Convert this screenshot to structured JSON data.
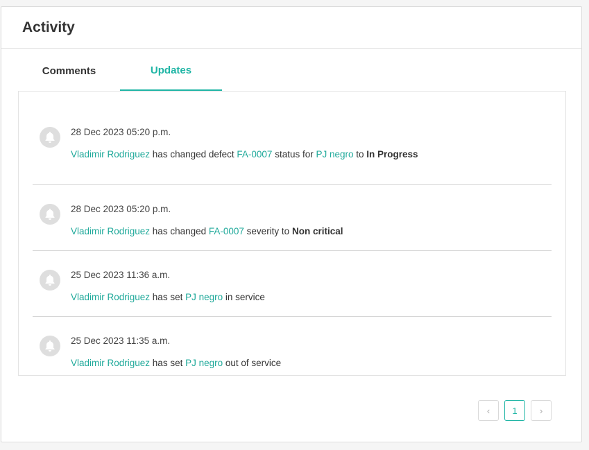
{
  "card": {
    "title": "Activity"
  },
  "tabs": [
    {
      "label": "Comments",
      "active": false
    },
    {
      "label": "Updates",
      "active": true
    }
  ],
  "activities": [
    {
      "time": "28 Dec 2023 05:20 p.m.",
      "user": "Vladimir Rodriguez",
      "t1": " has changed defect ",
      "defect": "FA-0007",
      "t2": " status for ",
      "asset": "PJ negro",
      "t3": " to ",
      "value": "In Progress"
    },
    {
      "time": "28 Dec 2023 05:20 p.m.",
      "user": "Vladimir Rodriguez",
      "t1": " has changed ",
      "defect": "FA-0007",
      "t2": " severity to ",
      "value": "Non critical"
    },
    {
      "time": "25 Dec 2023 11:36 a.m.",
      "user": "Vladimir Rodriguez",
      "t1": " has set ",
      "asset": "PJ negro",
      "t2": " in service"
    },
    {
      "time": "25 Dec 2023 11:35 a.m.",
      "user": "Vladimir Rodriguez",
      "t1": " has set ",
      "asset": "PJ negro",
      "t2": " out of service"
    }
  ],
  "pagination": {
    "prev": "‹",
    "current": "1",
    "next": "›"
  },
  "colors": {
    "accent": "#1fb5a5",
    "link": "#1fa99a",
    "avatar": "#dedede"
  },
  "icons": {
    "avatar": "bell-icon"
  }
}
